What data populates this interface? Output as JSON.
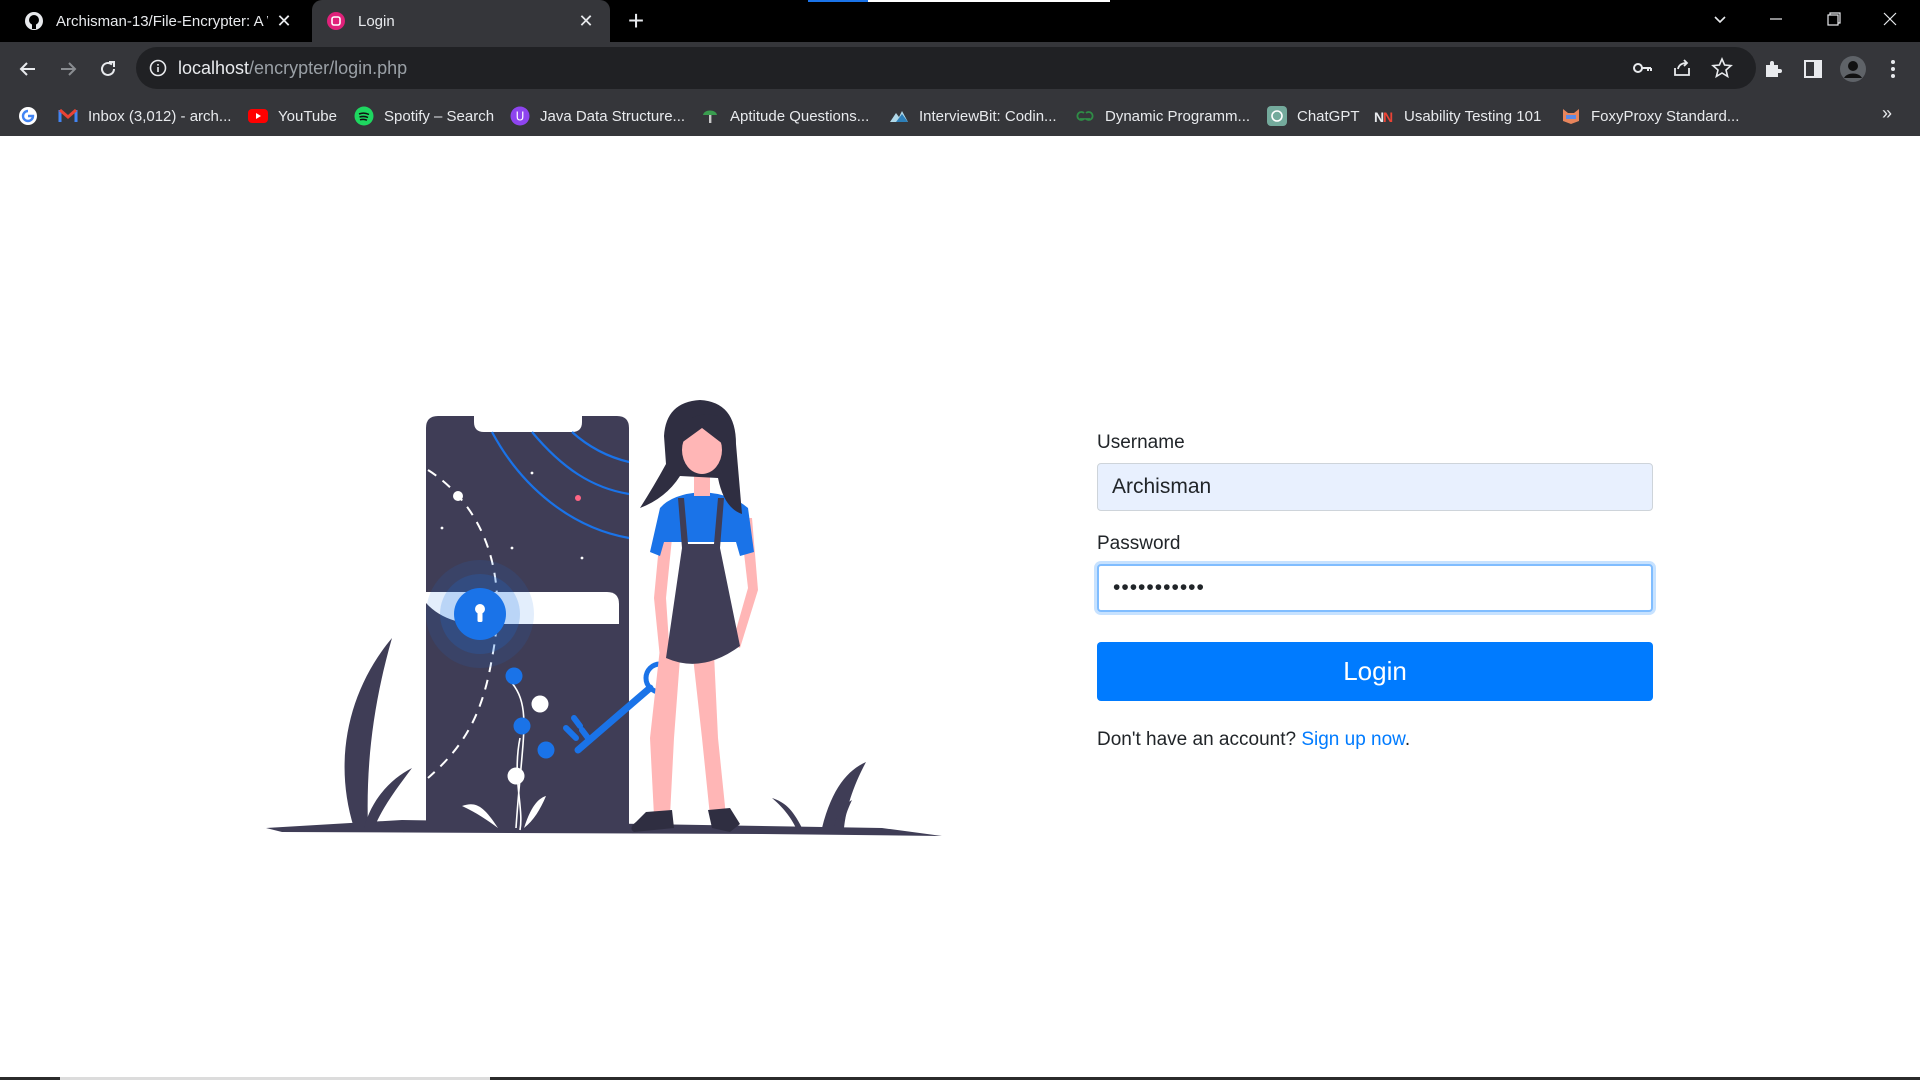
{
  "browser": {
    "tabs": [
      {
        "title": "Archisman-13/File-Encrypter: A W",
        "icon": "github-icon"
      },
      {
        "title": "Login",
        "icon": "page-favicon-icon"
      }
    ],
    "url_host": "localhost",
    "url_path": "/encrypter/login.php",
    "bookmarks": [
      {
        "label": "",
        "icon": "google-icon"
      },
      {
        "label": "Inbox (3,012) - arch...",
        "icon": "gmail-icon"
      },
      {
        "label": "YouTube",
        "icon": "youtube-icon"
      },
      {
        "label": "Spotify – Search",
        "icon": "spotify-icon"
      },
      {
        "label": "Java Data Structure...",
        "icon": "java-icon"
      },
      {
        "label": "Aptitude Questions...",
        "icon": "aptitude-icon"
      },
      {
        "label": "InterviewBit: Codin...",
        "icon": "interviewbit-icon"
      },
      {
        "label": "Dynamic Programm...",
        "icon": "gfg-icon"
      },
      {
        "label": "ChatGPT",
        "icon": "chatgpt-icon"
      },
      {
        "label": "Usability Testing 101",
        "icon": "nn-icon"
      },
      {
        "label": "FoxyProxy Standard...",
        "icon": "foxyproxy-icon"
      }
    ],
    "bookmarks_more": "»"
  },
  "login": {
    "username_label": "Username",
    "username_value": "Archisman",
    "password_label": "Password",
    "password_value": "•••••••••••",
    "button_label": "Login",
    "signup_prompt": "Don't have an account?",
    "signup_link": "Sign up now",
    "signup_end": "."
  },
  "colors": {
    "primary": "#007bff",
    "illustration_dark": "#3f3d56",
    "illustration_accent": "#1a73e8",
    "skin": "#ffb6b6"
  }
}
